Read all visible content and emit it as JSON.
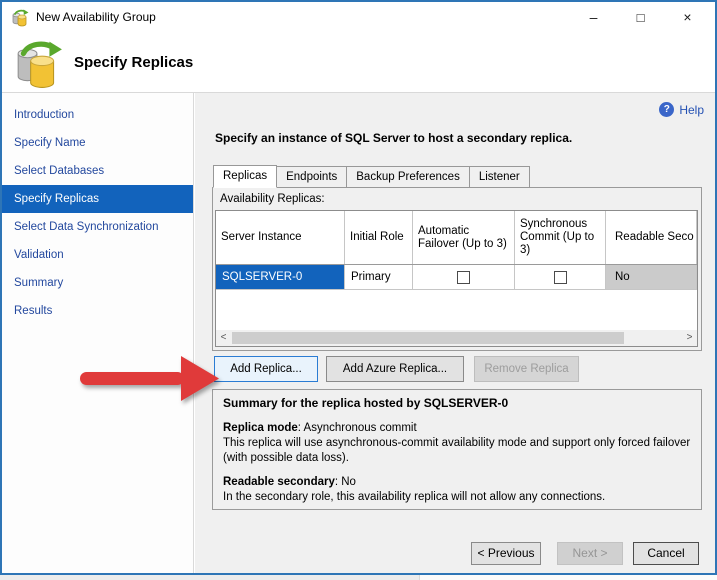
{
  "window": {
    "title": "New Availability Group",
    "controls": {
      "minimize": "–",
      "maximize": "□",
      "close": "×"
    }
  },
  "header": {
    "title": "Specify Replicas"
  },
  "sidebar": {
    "items": [
      {
        "label": "Introduction",
        "selected": false
      },
      {
        "label": "Specify Name",
        "selected": false
      },
      {
        "label": "Select Databases",
        "selected": false
      },
      {
        "label": "Specify Replicas",
        "selected": true
      },
      {
        "label": "Select Data Synchronization",
        "selected": false
      },
      {
        "label": "Validation",
        "selected": false
      },
      {
        "label": "Summary",
        "selected": false
      },
      {
        "label": "Results",
        "selected": false
      }
    ]
  },
  "main": {
    "help": {
      "label": "Help",
      "icon_glyph": "?"
    },
    "instruction": "Specify an instance of SQL Server to host a secondary replica.",
    "tabs": [
      {
        "label": "Replicas",
        "active": true
      },
      {
        "label": "Endpoints",
        "active": false
      },
      {
        "label": "Backup Preferences",
        "active": false
      },
      {
        "label": "Listener",
        "active": false
      }
    ],
    "replicas_tab": {
      "grid_label": "Availability Replicas:",
      "grid": {
        "columns": [
          "Server Instance",
          "Initial Role",
          "Automatic Failover (Up to 3)",
          "Synchronous Commit (Up to 3)",
          "Readable Seco"
        ],
        "row": {
          "server_instance": "SQLSERVER-0",
          "initial_role": "Primary",
          "automatic_failover_checked": false,
          "synchronous_commit_checked": false,
          "readable_secondary": "No"
        }
      },
      "scrollbar": {
        "left_arrow": "<",
        "right_arrow": ">"
      },
      "buttons": {
        "add_replica": "Add Replica...",
        "add_azure_replica": "Add Azure Replica...",
        "remove_replica": "Remove Replica"
      }
    },
    "summary": {
      "heading": "Summary for the replica hosted by SQLSERVER-0",
      "replica_mode_label": "Replica mode",
      "replica_mode_value": ": Asynchronous commit",
      "replica_mode_desc": "This replica will use asynchronous-commit availability mode and support only forced failover (with possible data loss).",
      "readable_secondary_label": "Readable secondary",
      "readable_secondary_value": ": No",
      "readable_secondary_desc": "In the secondary role, this availability replica will not allow any connections."
    },
    "footer_buttons": {
      "previous": "< Previous",
      "next": "Next >",
      "cancel": "Cancel"
    }
  },
  "annotations": {
    "red_arrow_color": "#e03a3a"
  },
  "colors": {
    "window_border": "#2e75b6",
    "selection_blue": "#1263bc",
    "sidebar_link": "#23489e",
    "panel_bg": "#f0f0f0",
    "readonly_cell_bg": "#cbcbcb"
  }
}
